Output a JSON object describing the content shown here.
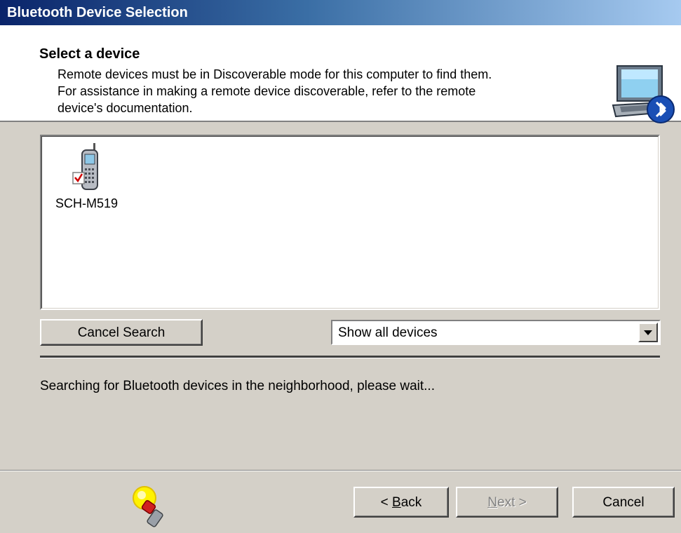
{
  "window": {
    "title": "Bluetooth Device Selection"
  },
  "header": {
    "title": "Select a device",
    "lines": [
      "Remote devices must be in Discoverable mode for this computer to find them.",
      "For assistance in making a remote device discoverable, refer to the remote",
      "device's documentation."
    ],
    "icon": "computer-bluetooth-icon"
  },
  "device_list": {
    "items": [
      {
        "name": "SCH-M519",
        "icon": "mobile-phone-icon",
        "checked": true
      }
    ]
  },
  "controls": {
    "cancel_search_label": "Cancel Search",
    "filter_selected": "Show all devices"
  },
  "status": {
    "text": "Searching for Bluetooth devices in the neighborhood, please wait..."
  },
  "footer": {
    "icon": "search-light-icon",
    "back": {
      "prefix": "< ",
      "mnemonic": "B",
      "rest": "ack"
    },
    "next": {
      "mnemonic": "N",
      "rest": "ext >",
      "enabled": false
    },
    "cancel_label": "Cancel"
  },
  "colors": {
    "titlebar_start": "#0a246a",
    "titlebar_end": "#a6caf0",
    "face": "#d4d0c8",
    "bluetooth_blue": "#1a4fb5"
  }
}
